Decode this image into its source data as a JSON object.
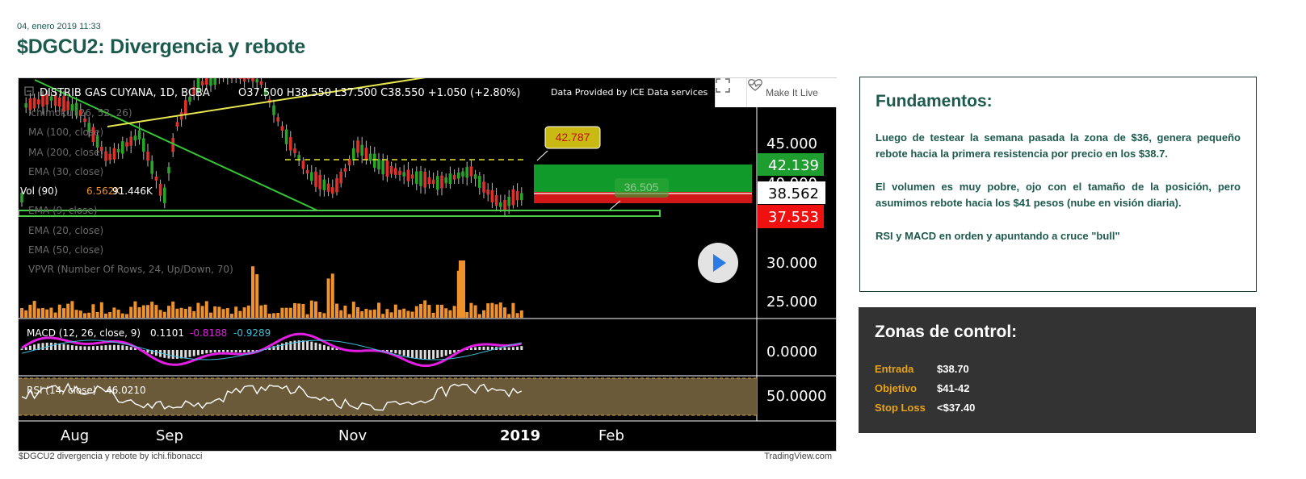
{
  "header": {
    "date": "04, enero 2019 11:33",
    "title": "$DGCU2: Divergencia y rebote"
  },
  "chart": {
    "symbol_line": "DISTRIB GAS CUYANA, 1D, BCBA",
    "ohlc": "O37.500  H38.550  L37.500  C38.550  +1.050 (+2.80%)",
    "data_provider": "Data Provided by ICE Data services",
    "fullscreen_icon": "expand-icon",
    "make_live_label": "Make It Live",
    "indicators": [
      "Ichimoku (26, 52, 26)",
      "MA (100, close)",
      "MA (200, close)",
      "EMA (30, close)",
      "Vol (90)",
      "EMA (9, close)",
      "EMA (20, close)",
      "EMA (50, close)",
      "VPVR (Number Of Rows, 24, Up/Down, 70)"
    ],
    "vol_values": [
      "6.562K",
      "91.446K"
    ],
    "price_labels": [
      {
        "text": "45.000"
      },
      {
        "text": "40.000"
      },
      {
        "text": "30.000"
      },
      {
        "text": "25.000"
      }
    ],
    "price_badges": [
      {
        "text": "42.139",
        "color": "#1e9e2e"
      },
      {
        "text": "38.562",
        "color": "#ffffff"
      },
      {
        "text": "37.553",
        "color": "#f01010"
      }
    ],
    "annotations": [
      {
        "text": "42.787"
      },
      {
        "text": "36.505"
      }
    ],
    "macd": {
      "label": "MACD (12, 26, close, 9)",
      "v1": "0.1101",
      "v2": "-0.8188",
      "v3": "-0.9289",
      "axis": "0.0000"
    },
    "rsi": {
      "label": "RSI (14, close)",
      "value": "46.0210",
      "axis": "50.0000"
    },
    "x_labels": [
      "Aug",
      "Sep",
      "Nov",
      "2019",
      "Feb"
    ],
    "colors": {
      "up": "#26a626",
      "down": "#e0302a",
      "volume": "#f0922b",
      "macd": "#e31ee3",
      "signal": "#40bcd8",
      "rsi": "#ffffff",
      "rsi_band": "#6b5a3a"
    }
  },
  "footer": {
    "caption": "$DGCU2 divergencia y rebote by ichi.fibonacci",
    "credit": "TradingView.com"
  },
  "fundamentals": {
    "title": "Fundamentos:",
    "paragraphs": [
      "Luego de testear la semana pasada la zona de $36, genera pequeño rebote hacia la primera resistencia por precio en los $38.7.",
      "El volumen es muy pobre, ojo con el tamaño de la posición, pero asumimos rebote hacia los $41 pesos (nube en visión diaria).",
      "RSI y MACD en orden y apuntando a cruce \"bull\""
    ]
  },
  "zones": {
    "title": "Zonas de control:",
    "rows": [
      {
        "label": "Entrada",
        "value": "$38.70"
      },
      {
        "label": "Objetivo",
        "value": "$41-42"
      },
      {
        "label": "Stop Loss",
        "value": "<$37.40"
      }
    ]
  }
}
